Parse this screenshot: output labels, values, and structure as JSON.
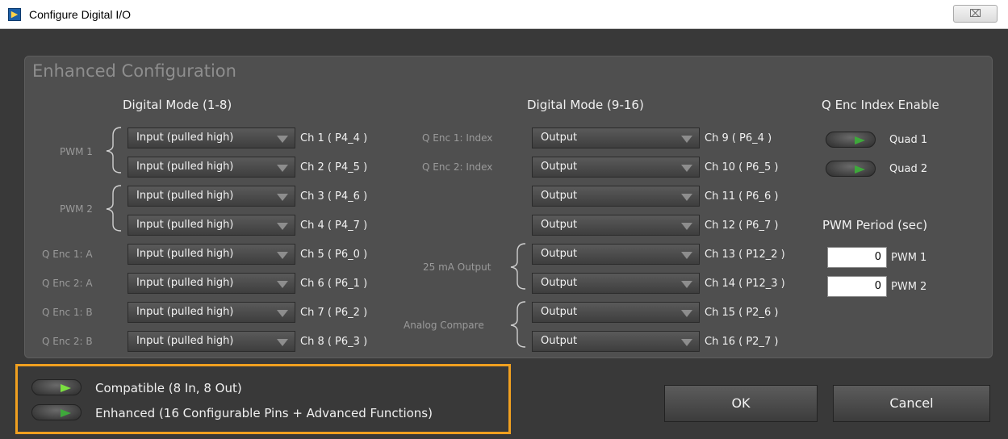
{
  "window": {
    "title": "Configure Digital I/O",
    "close_glyph": "⌧"
  },
  "panel": {
    "title": "Enhanced Configuration"
  },
  "left": {
    "header": "Digital Mode (1-8)",
    "groups": {
      "pwm1": "PWM 1",
      "pwm2": "PWM 2"
    },
    "rows": [
      {
        "label": "",
        "value": "Input (pulled high)",
        "channel": "Ch 1 ( P4_4 )"
      },
      {
        "label": "",
        "value": "Input (pulled high)",
        "channel": "Ch 2 ( P4_5 )"
      },
      {
        "label": "",
        "value": "Input (pulled high)",
        "channel": "Ch 3 ( P4_6 )"
      },
      {
        "label": "",
        "value": "Input (pulled high)",
        "channel": "Ch 4 ( P4_7 )"
      },
      {
        "label": "Q Enc 1: A",
        "value": "Input (pulled high)",
        "channel": "Ch 5 ( P6_0 )"
      },
      {
        "label": "Q Enc 2: A",
        "value": "Input (pulled high)",
        "channel": "Ch 6 ( P6_1 )"
      },
      {
        "label": "Q Enc 1: B",
        "value": "Input (pulled high)",
        "channel": "Ch 7 ( P6_2 )"
      },
      {
        "label": "Q Enc 2: B",
        "value": "Input (pulled high)",
        "channel": "Ch 8 ( P6_3 )"
      }
    ]
  },
  "right": {
    "header": "Digital Mode (9-16)",
    "groups": {
      "output25": "25 mA Output",
      "analog": "Analog Compare"
    },
    "rows": [
      {
        "label": "Q Enc 1: Index",
        "value": "Output",
        "channel": "Ch 9 ( P6_4 )"
      },
      {
        "label": "Q Enc 2: Index",
        "value": "Output",
        "channel": "Ch 10 ( P6_5 )"
      },
      {
        "label": "",
        "value": "Output",
        "channel": "Ch 11 ( P6_6 )"
      },
      {
        "label": "",
        "value": "Output",
        "channel": "Ch 12 ( P6_7 )"
      },
      {
        "label": "",
        "value": "Output",
        "channel": "Ch 13 ( P12_2 )"
      },
      {
        "label": "",
        "value": "Output",
        "channel": "Ch 14 ( P12_3 )"
      },
      {
        "label": "",
        "value": "Output",
        "channel": "Ch 15 ( P2_6 )"
      },
      {
        "label": "",
        "value": "Output",
        "channel": "Ch 16 ( P2_7 )"
      }
    ]
  },
  "qenc": {
    "header": "Q Enc Index Enable",
    "quad1": "Quad 1",
    "quad2": "Quad 2"
  },
  "pwm_period": {
    "header": "PWM Period (sec)",
    "pwm1_value": "0",
    "pwm1_label": "PWM 1",
    "pwm2_value": "0",
    "pwm2_label": "PWM 2"
  },
  "modes": {
    "compatible": "Compatible (8 In, 8 Out)",
    "enhanced": "Enhanced (16 Configurable Pins + Advanced Functions)"
  },
  "buttons": {
    "ok": "OK",
    "cancel": "Cancel"
  },
  "colors": {
    "led_on": "#7be040",
    "highlight_border": "#f0a020",
    "panel": "#4f4f4f"
  }
}
